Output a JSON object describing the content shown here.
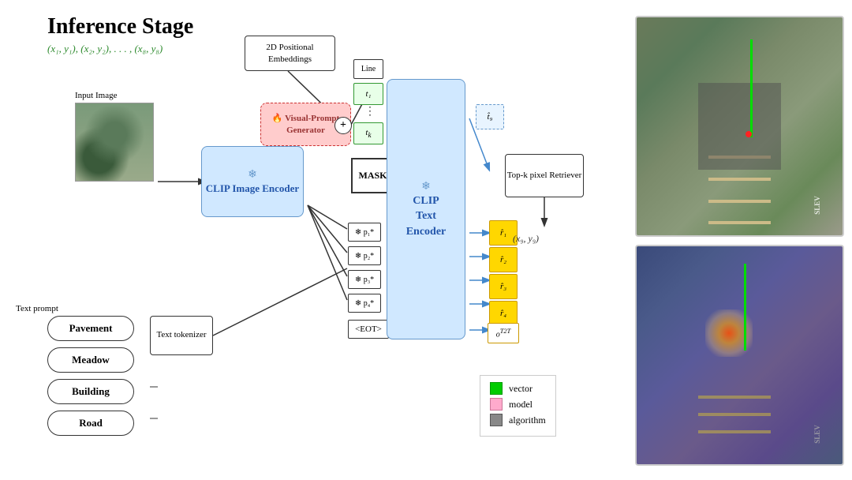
{
  "title": "Inference Stage",
  "history_path": "(x₁, y₁), (x₂, y₂), . . . , (x₈, y₈)",
  "labels": {
    "input_image": "Input Image",
    "text_prompt": "Text prompt",
    "clip_image_encoder": "CLIP Image\nEncoder",
    "clip_text_encoder": "CLIP\nText\nEncoder",
    "vpg": "🔥 Visual-Prompt\nGenerator",
    "pos_emb": "2D Positional\nEmbeddings",
    "topk": "Top-k pixel\nRetriever",
    "tokenizer": "Text\ntokenizer",
    "mask": "MASK",
    "eot": "<EOT>",
    "line": "Line",
    "coord_out": "(x₉, y₉)"
  },
  "prompts": [
    "Pavement",
    "Meadow",
    "Building",
    "Road"
  ],
  "legend": [
    {
      "color": "#00cc00",
      "label": "vector"
    },
    {
      "color": "#ff99aa",
      "label": "model"
    },
    {
      "color": "#888888",
      "label": "algorithm"
    }
  ],
  "tokens": {
    "t1": "t₁",
    "tk": "t_k",
    "p1": "p₁*",
    "p2": "p₂*",
    "p3": "p₃*",
    "p4": "p₄*",
    "t_hat": "t̂₉",
    "r1": "r̂₁",
    "r2": "r̂₂",
    "r3": "r̂₃",
    "r4": "r̂₄",
    "o_t2t": "o^T2T"
  }
}
